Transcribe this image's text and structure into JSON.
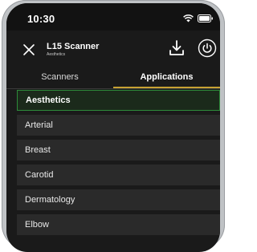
{
  "status_bar": {
    "time": "10:30"
  },
  "header": {
    "title": "L15 Scanner",
    "subtitle": "Aesthetics",
    "icons": [
      "close-icon",
      "download-icon",
      "power-icon"
    ]
  },
  "tabs": [
    {
      "label": "Scanners",
      "active": false
    },
    {
      "label": "Applications",
      "active": true
    }
  ],
  "applications": {
    "selected": "Aesthetics",
    "items": [
      {
        "label": "Aesthetics"
      },
      {
        "label": "Arterial"
      },
      {
        "label": "Breast"
      },
      {
        "label": "Carotid"
      },
      {
        "label": "Dermatology"
      },
      {
        "label": "Elbow"
      }
    ]
  },
  "colors": {
    "accent": "#c7a233",
    "selection_border": "#2e8b3a",
    "background": "#1a1a1a",
    "list_item_bg": "#2a2a2a"
  }
}
